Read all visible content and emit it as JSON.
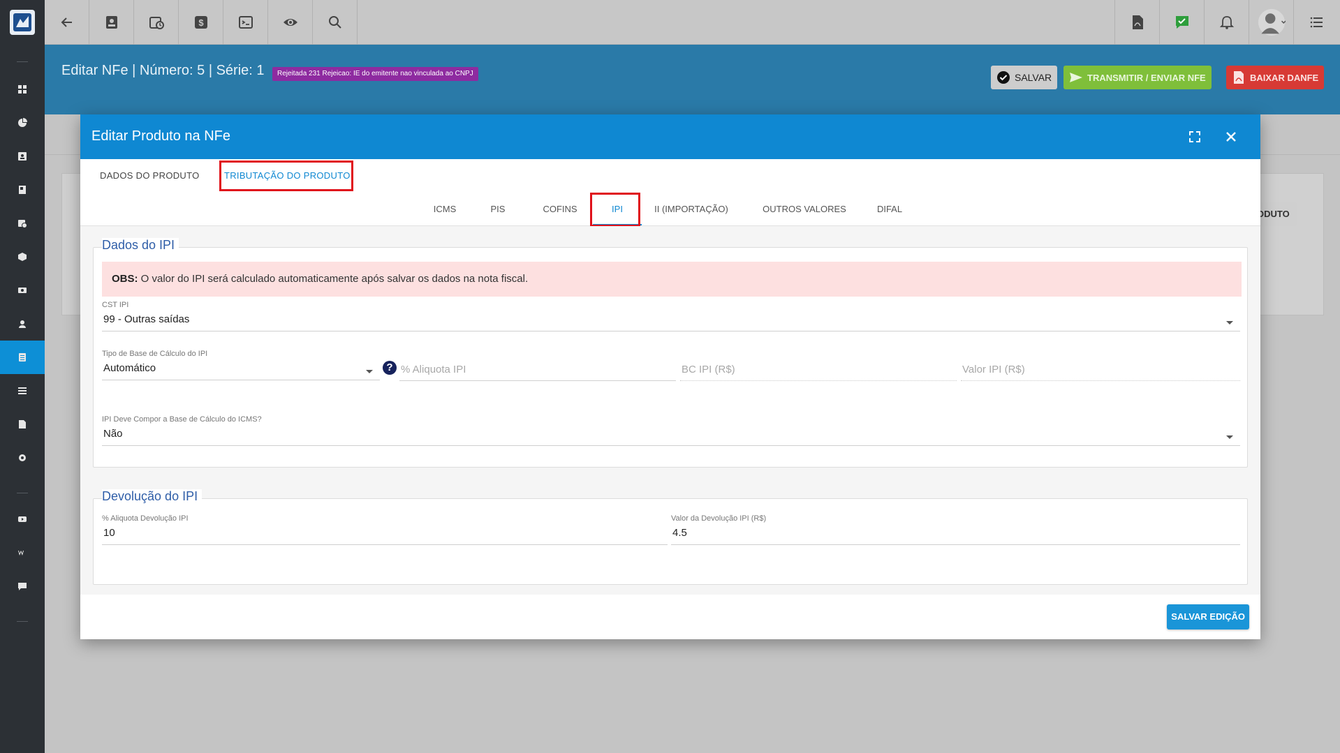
{
  "header": {
    "title": "Editar NFe | Número: 5 | Série: 1",
    "status_badge": "Rejeitada 231 Rejeicao: IE do emitente nao vinculada ao CNPJ",
    "save_label": "SALVAR",
    "transmit_label": "TRANSMITIR / ENVIAR NFE",
    "danfe_label": "BAIXAR DANFE"
  },
  "background": {
    "partial_button": "ODUTO"
  },
  "modal": {
    "title": "Editar Produto na NFe",
    "main_tabs": [
      "DADOS DO PRODUTO",
      "TRIBUTAÇÃO DO PRODUTO"
    ],
    "sub_tabs": [
      "ICMS",
      "PIS",
      "COFINS",
      "IPI",
      "II (IMPORTAÇÃO)",
      "OUTROS VALORES",
      "DIFAL"
    ],
    "ipi_section": {
      "legend": "Dados do IPI",
      "obs_label": "OBS:",
      "obs_text": " O valor do IPI será calculado automaticamente após salvar os dados na nota fiscal.",
      "cst_label": "CST IPI",
      "cst_value": "99 - Outras saídas",
      "base_type_label": "Tipo de Base de Cálculo do IPI",
      "base_type_value": "Automático",
      "help_glyph": "?",
      "aliquota_placeholder": "% Aliquota IPI",
      "bc_placeholder": "BC IPI (R$)",
      "valor_placeholder": "Valor IPI (R$)",
      "compor_label": "IPI Deve Compor a Base de Cálculo do ICMS?",
      "compor_value": "Não"
    },
    "devolucao_section": {
      "legend": "Devolução do IPI",
      "aliquota_label": "% Aliquota Devolução IPI",
      "aliquota_value": "10",
      "valor_label": "Valor da Devolução IPI (R$)",
      "valor_value": "4.5"
    },
    "save_edit_label": "SALVAR EDIÇÃO"
  },
  "colors": {
    "primary": "#0f88d2",
    "band": "#2a7aa8",
    "sidebar": "#2c3035",
    "highlight": "#e0121b",
    "badge": "#8e2ba0",
    "success": "#7fbf3a",
    "danger": "#d73a35"
  }
}
